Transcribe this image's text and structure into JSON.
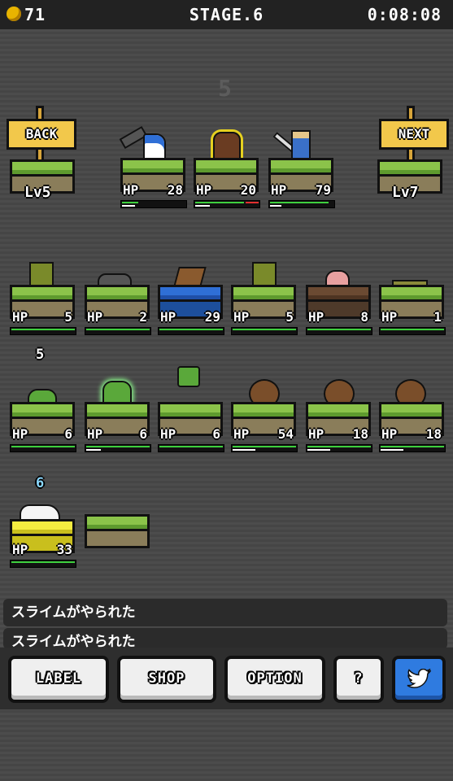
{
  "header": {
    "coins": "71",
    "stage": "STAGE.6",
    "timer": "0:08:08"
  },
  "party_wave": "5",
  "nav": {
    "back_label": "BACK",
    "next_label": "NEXT",
    "prev_level": "Lv5",
    "next_level": "Lv7"
  },
  "party": [
    {
      "name": "mage",
      "hp_label": "HP",
      "hp": "28"
    },
    {
      "name": "monk",
      "hp_label": "HP",
      "hp": "20"
    },
    {
      "name": "swordsman",
      "hp_label": "HP",
      "hp": "79"
    }
  ],
  "enemies_row1": [
    {
      "name": "goblin",
      "hp_label": "HP",
      "hp": "5"
    },
    {
      "name": "rat",
      "hp_label": "HP",
      "hp": "2"
    },
    {
      "name": "shark",
      "hp_label": "HP",
      "hp": "29"
    },
    {
      "name": "goblin",
      "hp_label": "HP",
      "hp": "5"
    },
    {
      "name": "mushroom",
      "hp_label": "HP",
      "hp": "8"
    },
    {
      "name": "crocodile",
      "hp_label": "HP",
      "hp": "1"
    }
  ],
  "wave2_label": "5",
  "enemies_row2": [
    {
      "name": "slime",
      "hp_label": "HP",
      "hp": "6"
    },
    {
      "name": "slime",
      "hp_label": "HP",
      "hp": "6"
    },
    {
      "name": "slime",
      "hp_label": "HP",
      "hp": "6"
    },
    {
      "name": "rock-golem",
      "hp_label": "HP",
      "hp": "54"
    },
    {
      "name": "rock-golem",
      "hp_label": "HP",
      "hp": "18"
    },
    {
      "name": "rock-golem",
      "hp_label": "HP",
      "hp": "18"
    }
  ],
  "wave3_label": "6",
  "enemies_row3": [
    {
      "name": "bird",
      "hp_label": "HP",
      "hp": "33"
    }
  ],
  "messages": [
    "スライムがやられた",
    "スライムがやられた"
  ],
  "buttons": {
    "label": "LABEL",
    "shop": "SHOP",
    "option": "OPTION",
    "help": "?"
  },
  "colors": {
    "grass": "#8bc34a",
    "hp_bar": "#3ecf3e",
    "twitter": "#2f7be0",
    "sign": "#f2c84b"
  }
}
